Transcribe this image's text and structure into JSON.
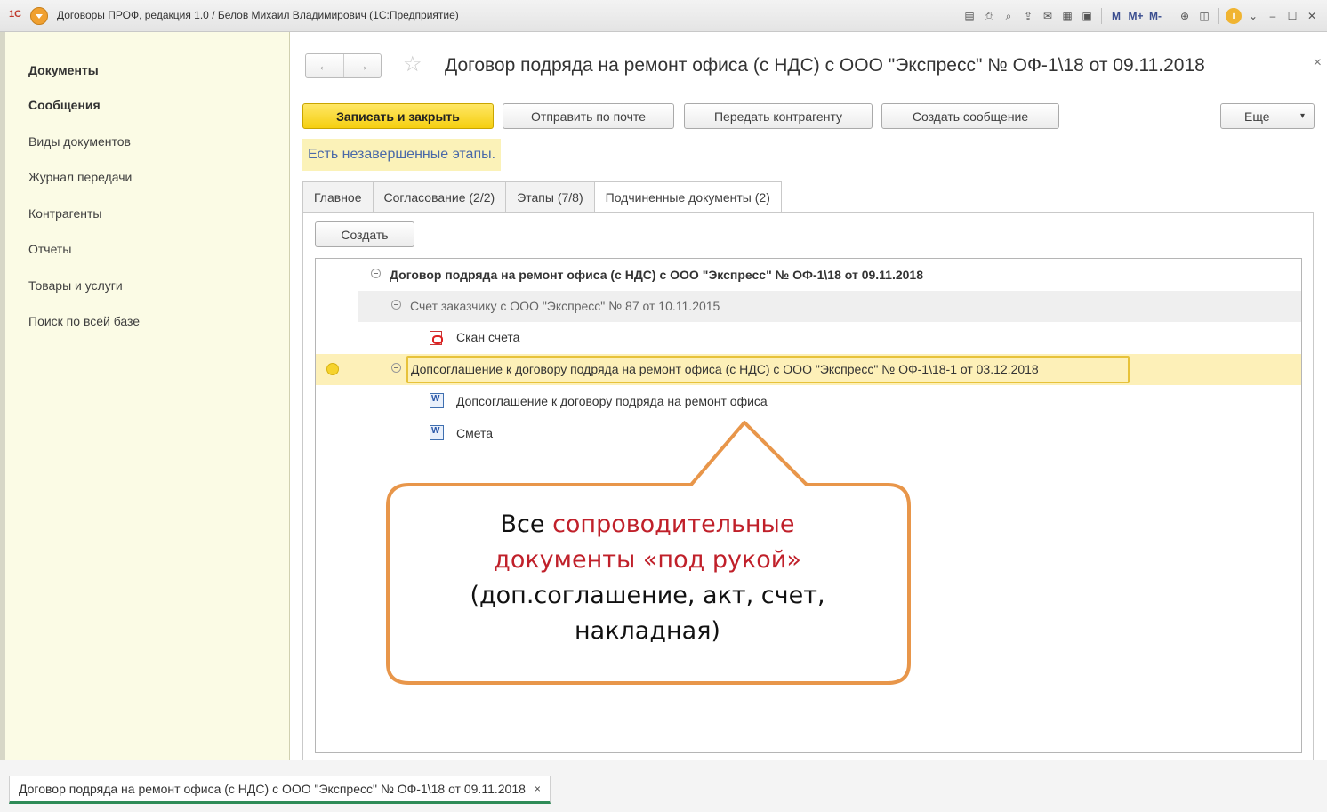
{
  "window": {
    "logo": "1С",
    "title": "Договоры ПРОФ, редакция 1.0 / Белов Михаил Владимирович  (1С:Предприятие)",
    "tools": [
      "M",
      "M+",
      "M-"
    ]
  },
  "sidebar": {
    "items": [
      {
        "label": "Документы",
        "bold": true
      },
      {
        "label": "Сообщения",
        "bold": true
      },
      {
        "label": "Виды документов",
        "bold": false
      },
      {
        "label": "Журнал передачи",
        "bold": false
      },
      {
        "label": "Контрагенты",
        "bold": false
      },
      {
        "label": "Отчеты",
        "bold": false
      },
      {
        "label": "Товары и услуги",
        "bold": false
      },
      {
        "label": "Поиск по всей базе",
        "bold": false
      }
    ]
  },
  "form": {
    "title": "Договор подряда на ремонт офиса (с НДС) с ООО \"Экспресс\" № ОФ-1\\18 от 09.11.2018",
    "close": "×",
    "toolbar": {
      "save_close": "Записать и закрыть",
      "send_mail": "Отправить по почте",
      "send_counterparty": "Передать контрагенту",
      "create_message": "Создать сообщение",
      "more": "Еще"
    },
    "warning": "Есть незавершенные этапы.",
    "tabs": [
      {
        "label": "Главное",
        "active": false
      },
      {
        "label": "Согласование (2/2)",
        "active": false
      },
      {
        "label": "Этапы (7/8)",
        "active": false
      },
      {
        "label": "Подчиненные документы (2)",
        "active": true
      }
    ],
    "create_button": "Создать",
    "tree": [
      {
        "label": "Договор подряда на ремонт офиса (с НДС) с ООО \"Экспресс\" № ОФ-1\\18 от 09.11.2018",
        "level": 0,
        "kind": "group",
        "bold": true
      },
      {
        "label": "Счет заказчику с ООО \"Экспресс\" № 87 от 10.11.2015",
        "level": 1,
        "kind": "group",
        "bold": false
      },
      {
        "label": "Скан счета",
        "level": 2,
        "kind": "pdf",
        "bold": false
      },
      {
        "label": "Допсоглашение к договору подряда на ремонт офиса (с НДС) с ООО \"Экспресс\" № ОФ-1\\18-1 от 03.12.2018",
        "level": 1,
        "kind": "group",
        "bold": false,
        "selected": true
      },
      {
        "label": "Допсоглашение к договору подряда на ремонт офиса",
        "level": 2,
        "kind": "word",
        "bold": false
      },
      {
        "label": "Смета",
        "level": 2,
        "kind": "word",
        "bold": false
      }
    ]
  },
  "callout": {
    "line1_plain": "Все ",
    "line1_red": "сопроводительные",
    "line2_red": "документы «под рукой»",
    "line3": "(доп.соглашение, акт, счет,",
    "line4": "накладная)"
  },
  "taskbar": {
    "open_tab": "Договор подряда на ремонт офиса (с НДС) с ООО \"Экспресс\" № ОФ-1\\18 от 09.11.2018",
    "close": "×"
  },
  "colors": {
    "primary_button": "#f5cf10",
    "sidebar_bg": "#fbfbe5",
    "selected_row": "#fdf0b8",
    "callout_border": "#e8964a",
    "callout_red": "#c0202a"
  }
}
